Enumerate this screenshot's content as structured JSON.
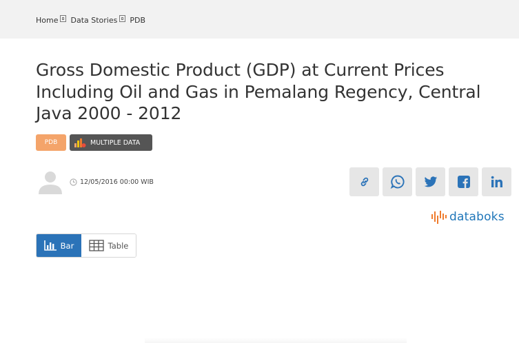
{
  "breadcrumb": {
    "items": [
      "Home",
      "Data Stories",
      "PDB"
    ]
  },
  "article": {
    "title_line1": "Gross Domestic Product (GDP) at Current Prices",
    "title_line2": "Including Oil and Gas in Pemalang Regency, Central",
    "title_line3": "Java 2000 - 2012",
    "tag_category": "PDB",
    "tag_multiple": "MULTIPLE DATA",
    "date": "12/05/2016 00:00 WIB"
  },
  "share": {
    "icons": [
      "link-icon",
      "whatsapp-icon",
      "twitter-icon",
      "facebook-icon",
      "linkedin-icon"
    ]
  },
  "logo": {
    "text": "databoks"
  },
  "view_toggle": {
    "bar_label": "Bar",
    "table_label": "Table"
  },
  "colors": {
    "accent_blue": "#2b73b8",
    "tag_orange": "#f4a46a",
    "tag_dark": "#555555",
    "logo_blue": "#1f76b9",
    "logo_orange": "#ef7b2d"
  }
}
